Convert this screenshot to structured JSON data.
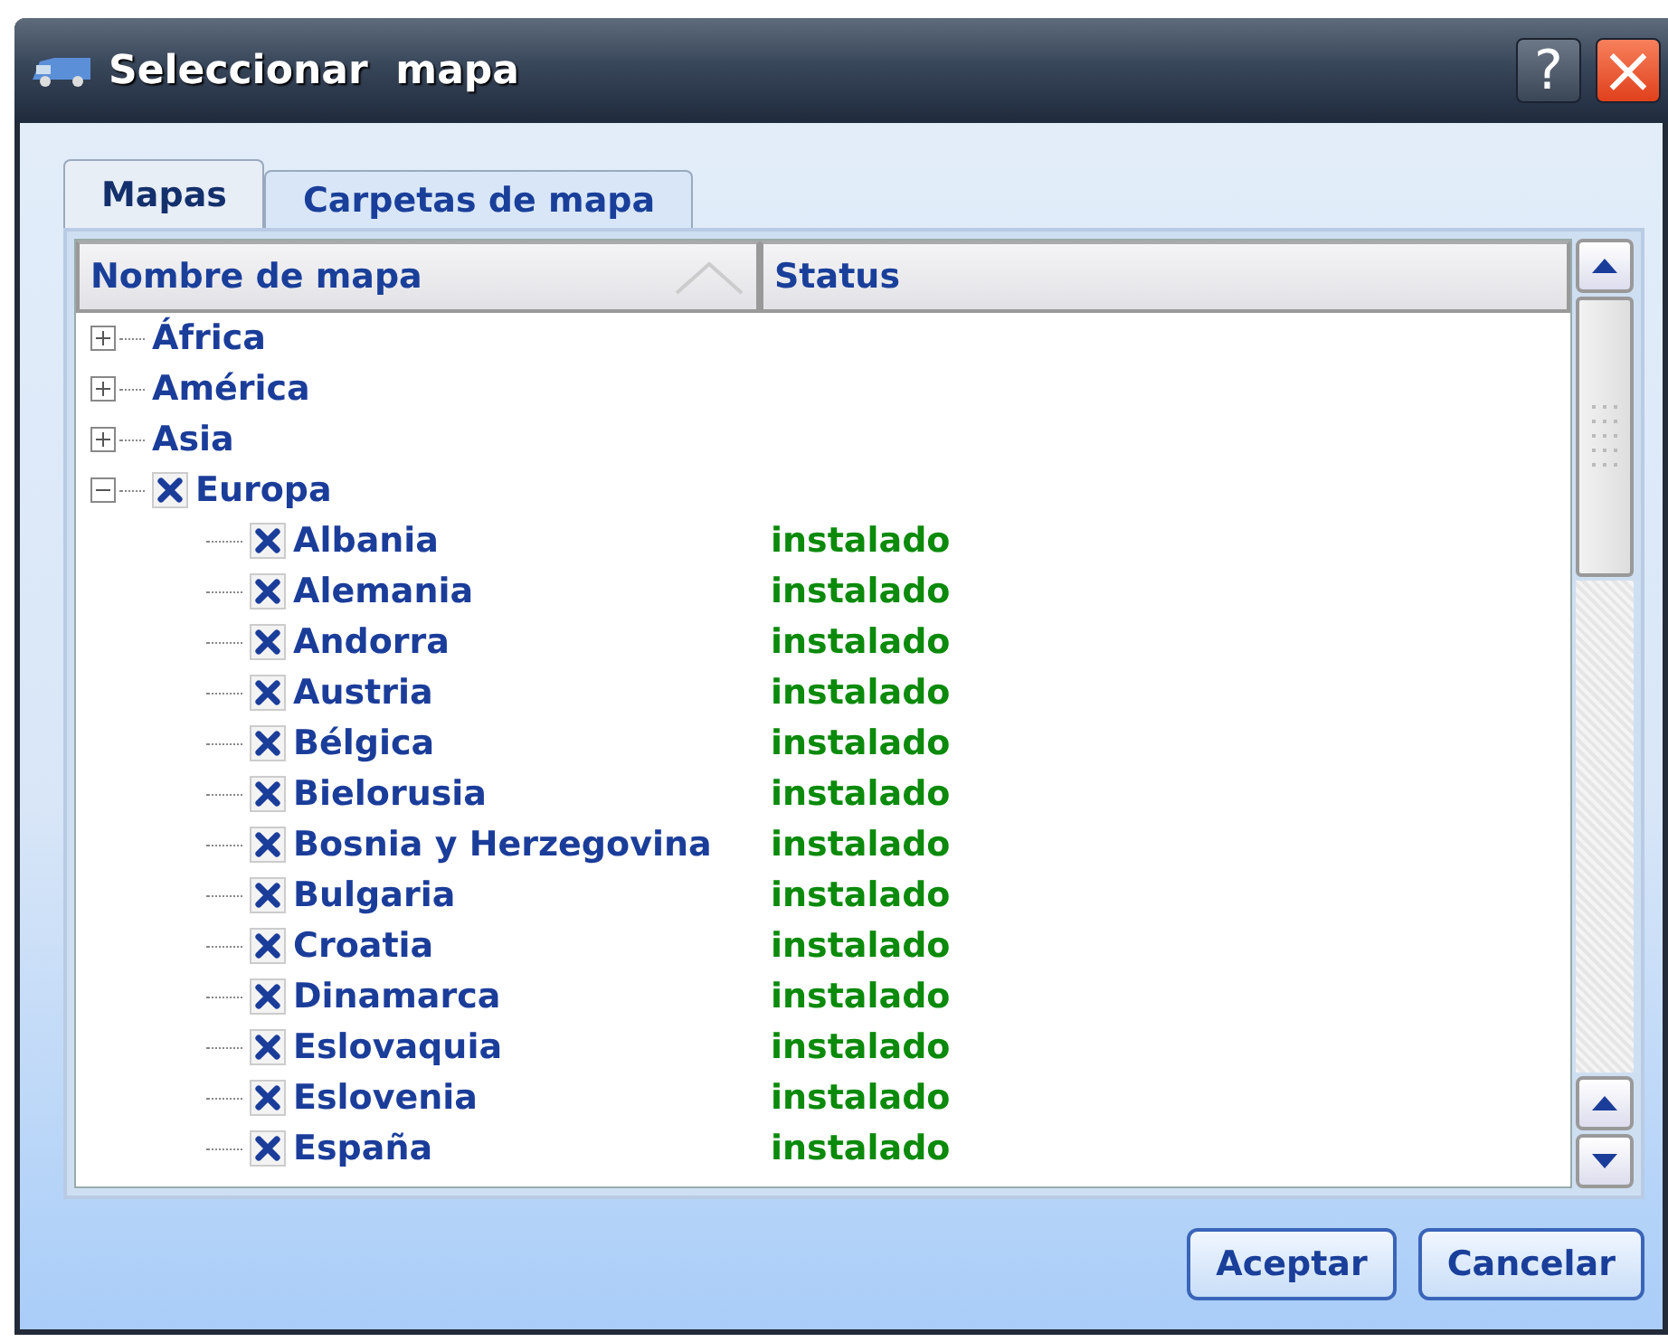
{
  "window": {
    "title": "Seleccionar  mapa",
    "help": "?",
    "close": "×"
  },
  "tabs": [
    {
      "label": "Mapas",
      "selected": true
    },
    {
      "label": "Carpetas de mapa",
      "selected": false
    }
  ],
  "columns": [
    {
      "label": "Nombre de mapa",
      "sorted": true
    },
    {
      "label": "Status",
      "sorted": false
    }
  ],
  "tree": [
    {
      "label": "África",
      "kind": "folder",
      "expanded": false
    },
    {
      "label": "América",
      "kind": "folder",
      "expanded": false
    },
    {
      "label": "Asia",
      "kind": "folder",
      "expanded": false
    },
    {
      "label": "Europa",
      "kind": "map",
      "checked": true,
      "expanded": true,
      "children": [
        {
          "label": "Albania",
          "checked": true,
          "status": "instalado"
        },
        {
          "label": "Alemania",
          "checked": true,
          "status": "instalado"
        },
        {
          "label": "Andorra",
          "checked": true,
          "status": "instalado"
        },
        {
          "label": "Austria",
          "checked": true,
          "status": "instalado"
        },
        {
          "label": "Bélgica",
          "checked": true,
          "status": "instalado"
        },
        {
          "label": "Bielorusia",
          "checked": true,
          "status": "instalado"
        },
        {
          "label": "Bosnia y Herzegovina",
          "checked": true,
          "status": "instalado"
        },
        {
          "label": "Bulgaria",
          "checked": true,
          "status": "instalado"
        },
        {
          "label": "Croatia",
          "checked": true,
          "status": "instalado"
        },
        {
          "label": "Dinamarca",
          "checked": true,
          "status": "instalado"
        },
        {
          "label": "Eslovaquia",
          "checked": true,
          "status": "instalado"
        },
        {
          "label": "Eslovenia",
          "checked": true,
          "status": "instalado"
        },
        {
          "label": "España",
          "checked": true,
          "status": "instalado"
        }
      ]
    }
  ],
  "buttons": [
    "Aceptar",
    "Cancelar"
  ]
}
